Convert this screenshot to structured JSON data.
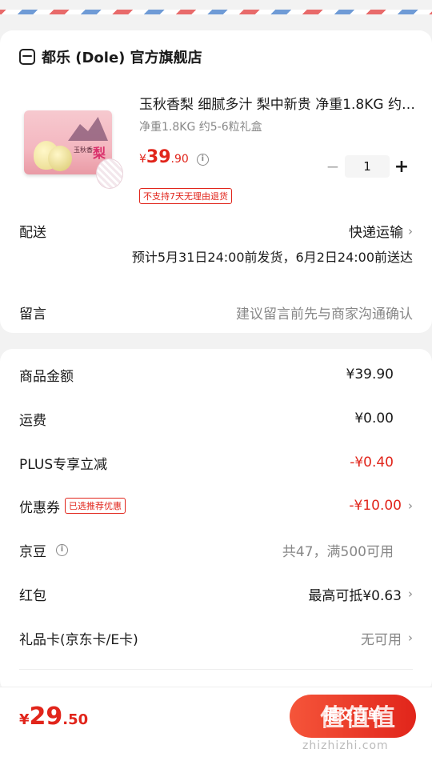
{
  "store": {
    "name": "都乐 (Dole) 官方旗舰店"
  },
  "product": {
    "title": "玉秋香梨 细腻多汁 梨中新贵 净重1.8KG 约5-6粒礼盒",
    "spec": "净重1.8KG 约5-6粒礼盒",
    "price": {
      "currency": "¥",
      "integer": "39",
      "decimal": ".90"
    },
    "quantity": "1",
    "return_tag": "不支持7天无理由退货",
    "box_text": "玉秋香",
    "box_big": "梨"
  },
  "delivery": {
    "label": "配送",
    "method": "快递运输",
    "estimate": "预计5月31日24:00前发货，6月2日24:00前送达"
  },
  "message": {
    "label": "留言",
    "placeholder": "建议留言前先与商家沟通确认"
  },
  "fees": {
    "goods": {
      "label": "商品金额",
      "value": "¥39.90"
    },
    "shipping": {
      "label": "运费",
      "value": "¥0.00"
    },
    "plus": {
      "label": "PLUS专享立减",
      "value": "-¥0.40"
    },
    "coupon": {
      "label": "优惠券",
      "tag": "已选推荐优惠",
      "value": "-¥10.00"
    },
    "jingdou": {
      "label": "京豆",
      "value": "共47，满500可用"
    },
    "hongbao": {
      "label": "红包",
      "value": "最高可抵¥0.63"
    },
    "giftcard": {
      "label": "礼品卡(京东卡/E卡)",
      "value": "无可用"
    }
  },
  "footer": {
    "total": {
      "currency": "¥",
      "integer": "29",
      "decimal": ".50"
    },
    "submit_label": "提交订单"
  },
  "watermark": {
    "logo": "值值值",
    "url": "zhizhizhi.com"
  },
  "icons": {
    "chevron": "›",
    "info": "i",
    "minus": "−",
    "plus": "+"
  }
}
